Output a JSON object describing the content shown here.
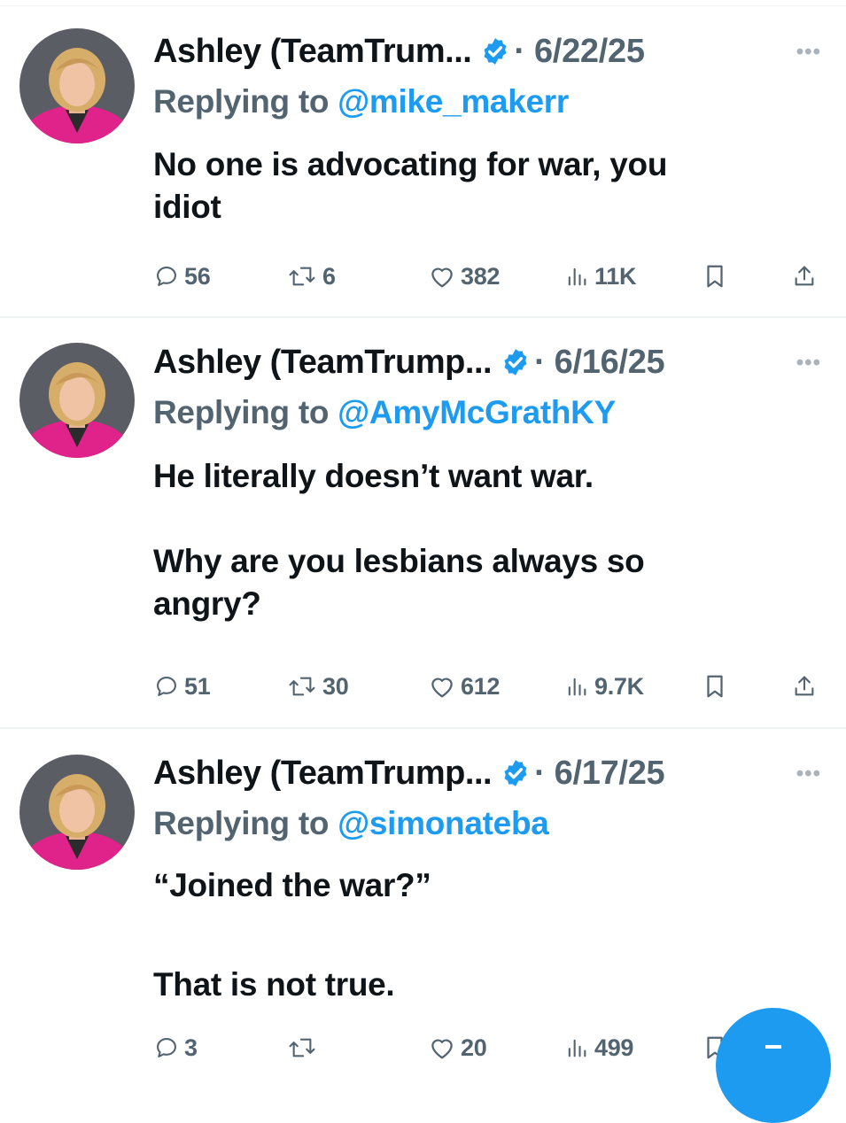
{
  "accent_color": "#1d9bf0",
  "muted_color": "#536471",
  "tweets": [
    {
      "name": "Ashley (TeamTrum...",
      "date": "· 6/22/25",
      "reply_prefix": "Replying to ",
      "reply_handle": "@mike_makerr",
      "body": [
        "No one is advocating for war, you",
        "idiot"
      ],
      "replies": "56",
      "reposts": "6",
      "likes": "382",
      "views": "11K"
    },
    {
      "name": "Ashley (TeamTrump...",
      "date": "· 6/16/25",
      "reply_prefix": "Replying to ",
      "reply_handle": "@AmyMcGrathKY",
      "body": [
        "He literally doesn’t want war.",
        "",
        "Why are you lesbians always so",
        "angry?"
      ],
      "replies": "51",
      "reposts": "30",
      "likes": "612",
      "views": "9.7K"
    },
    {
      "name": "Ashley (TeamTrump...",
      "date": "· 6/17/25",
      "reply_prefix": "Replying to ",
      "reply_handle": "@simonateba",
      "body": [
        "“Joined the war?”",
        "",
        "That is not true."
      ],
      "replies": "3",
      "reposts": "",
      "likes": "20",
      "views": "499"
    }
  ],
  "icons": [
    "verified-badge-icon",
    "more-icon",
    "reply-icon",
    "repost-icon",
    "like-icon",
    "views-icon",
    "bookmark-icon",
    "share-icon",
    "compose-icon"
  ]
}
